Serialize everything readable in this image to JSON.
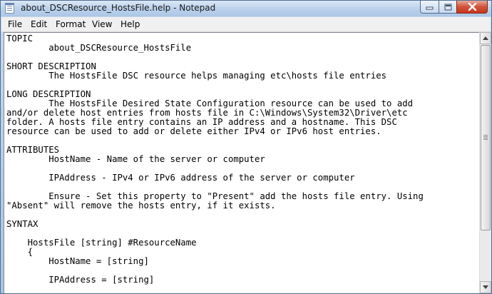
{
  "window": {
    "title": "about_DSCResource_HostsFile.help - Notepad",
    "app_icon": "notepad-icon",
    "controls": {
      "minimize_icon": "minimize-icon",
      "maximize_icon": "maximize-icon",
      "close_icon": "close-icon"
    }
  },
  "menu": {
    "items": [
      {
        "label": "File",
        "name": "menu-file"
      },
      {
        "label": "Edit",
        "name": "menu-edit"
      },
      {
        "label": "Format",
        "name": "menu-format"
      },
      {
        "label": "View",
        "name": "menu-view"
      },
      {
        "label": "Help",
        "name": "menu-help"
      }
    ]
  },
  "document": {
    "text": "TOPIC\n        about_DSCResource_HostsFile\n\nSHORT DESCRIPTION\n        The HostsFile DSC resource helps managing etc\\hosts file entries\n\nLONG DESCRIPTION\n        The HostsFile Desired State Configuration resource can be used to add\nand/or delete host entries from hosts file in C:\\Windows\\System32\\Driver\\etc\nfolder. A hosts file entry contains an IP address and a hostname. This DSC\nresource can be used to add or delete either IPv4 or IPv6 host entries.\n\nATTRIBUTES\n        HostName - Name of the server or computer\n\n        IPAddress - IPv4 or IPv6 address of the server or computer\n\n        Ensure - Set this property to \"Present\" add the hosts file entry. Using\n\"Absent\" will remove the hosts entry, if it exists.\n\nSYNTAX\n\n    HostsFile [string] #ResourceName\n    {\n        HostName = [string]\n\n        IPAddress = [string]"
  },
  "scrollbar": {
    "up_icon": "scroll-up-arrow-icon",
    "down_icon": "scroll-down-arrow-icon"
  }
}
